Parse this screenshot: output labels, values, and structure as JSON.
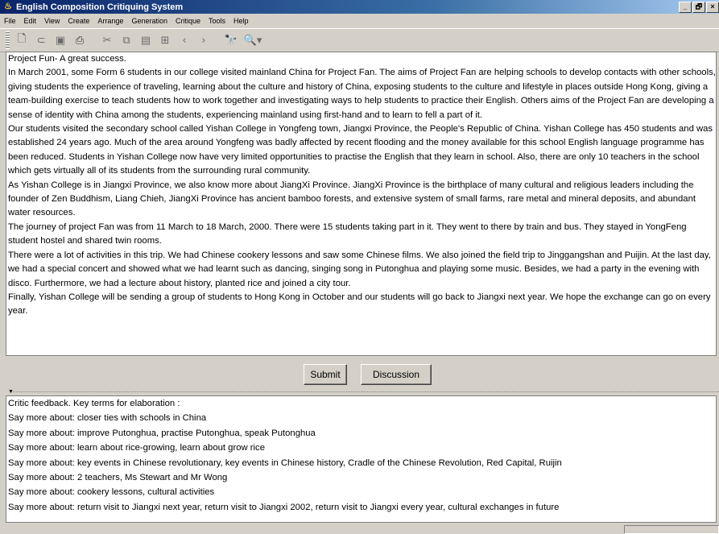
{
  "window": {
    "title": "English Composition Critiquing System",
    "controls": [
      "_",
      "🗗",
      "×"
    ]
  },
  "menubar": {
    "items": [
      "File",
      "Edit",
      "View",
      "Create",
      "Arrange",
      "Generation",
      "Critique",
      "Tools",
      "Help"
    ]
  },
  "toolbar": {
    "buttons": [
      {
        "icon": "new-file-icon",
        "glyph": "🗋"
      },
      {
        "icon": "open-icon",
        "glyph": "⊂"
      },
      {
        "icon": "save-icon",
        "glyph": "▣"
      },
      {
        "icon": "print-icon",
        "glyph": "⎙"
      },
      {
        "icon": "cut-icon",
        "glyph": "✂"
      },
      {
        "icon": "copy-icon",
        "glyph": "⧉"
      },
      {
        "icon": "paste-icon",
        "glyph": "▤"
      },
      {
        "icon": "properties-icon",
        "glyph": "⊞"
      },
      {
        "icon": "back-icon",
        "glyph": "‹"
      },
      {
        "icon": "forward-icon",
        "glyph": "›"
      },
      {
        "icon": "find-icon",
        "glyph": "🔭"
      },
      {
        "icon": "zoom-icon",
        "glyph": "🔍▾"
      }
    ]
  },
  "document": {
    "paragraphs": [
      "Project Fun- A great success.",
      "In March 2001, some Form 6 students in our college visited mainland China for Project Fan. The aims of Project Fan are helping schools to develop contacts with other schools, giving students the experience of traveling, learning about the culture and history of China, exposing students to the culture and lifestyle in places outside Hong Kong, giving a team-building exercise to teach students how to work together and investigating ways to help students to practice their English. Others aims of the Project Fan are developing a sense of identity with China among the students, experiencing mainland using first-hand and to learn to fell a part of it.",
      "Our students visited the secondary school called Yishan College in Yongfeng town, Jiangxi Province, the People's Republic of China. Yishan College has 450 students and was established 24 years ago. Much of the area around Yongfeng was badly affected by recent flooding and the money available for this school English language programme has been reduced. Students in Yishan College now have very limited opportunities to practise the English that they learn in school. Also, there are only 10 teachers in the school which gets virtually all of its students from the surrounding rural community.",
      "As Yishan College is in Jiangxi Province, we also know more about JiangXi Province. JiangXi Province is the birthplace of many cultural and religious leaders including the founder of Zen Buddhism, Liang Chieh, JiangXi Province has ancient bamboo forests, and extensive system of small farms, rare metal and mineral deposits, and abundant water resources.",
      "The journey of project Fan was from 11 March to 18 March, 2000. There were 15 students taking part in it. They went to there by train and bus. They stayed in YongFeng student hostel and shared twin rooms.",
      "There were a lot of activities in this trip. We had Chinese cookery lessons and saw some Chinese films. We also joined the field trip to Jinggangshan and Puijin. At the last day, we had a special concert and showed what we had learnt such as dancing, singing song in Putonghua and playing some music. Besides, we had a party in the evening with disco. Furthermore, we had a lecture about history, planted rice and joined a city tour.",
      "Finally, Yishan College will be sending a group of students to Hong Kong in October and our students will go back to Jiangxi next year. We hope the exchange can go on every year."
    ]
  },
  "actions": {
    "submit": "Submit",
    "discussion": "Discussion"
  },
  "feedback": {
    "header": "Critic feedback. Key terms for elaboration :",
    "lines": [
      "Say more about: closer ties with schools in China",
      "Say more about: improve Putonghua, practise Putonghua, speak Putonghua",
      "Say more about: learn about rice-growing, learn about grow rice",
      "Say more about: key events in Chinese revolutionary, key events in Chinese history, Cradle of the Chinese Revolution, Red Capital, Ruijin",
      "Say more about: 2 teachers, Ms Stewart and Mr Wong",
      "Say more about: cookery lessons, cultural activities",
      "Say more about: return visit to Jiangxi next year, return visit to Jiangxi 2002, return visit to Jiangxi every year, cultural exchanges in future"
    ]
  }
}
